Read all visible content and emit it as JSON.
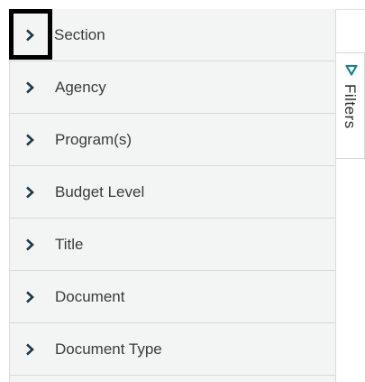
{
  "filter_panel": {
    "items": [
      {
        "label": "Section",
        "icon": "chevron-right-icon"
      },
      {
        "label": "Agency",
        "icon": "chevron-right-icon"
      },
      {
        "label": "Program(s)",
        "icon": "chevron-right-icon"
      },
      {
        "label": "Budget Level",
        "icon": "chevron-right-icon"
      },
      {
        "label": "Title",
        "icon": "chevron-right-icon"
      },
      {
        "label": "Document",
        "icon": "chevron-right-icon"
      },
      {
        "label": "Document Type",
        "icon": "chevron-right-icon"
      }
    ]
  },
  "filters_tab": {
    "label": "Filters",
    "icon": "funnel-icon"
  },
  "colors": {
    "chevron": "#1a3a4a",
    "funnel": "#1f7f8a",
    "panel_bg": "#f3f4f4",
    "divider": "#d7dada",
    "text": "#3b3b3b"
  }
}
